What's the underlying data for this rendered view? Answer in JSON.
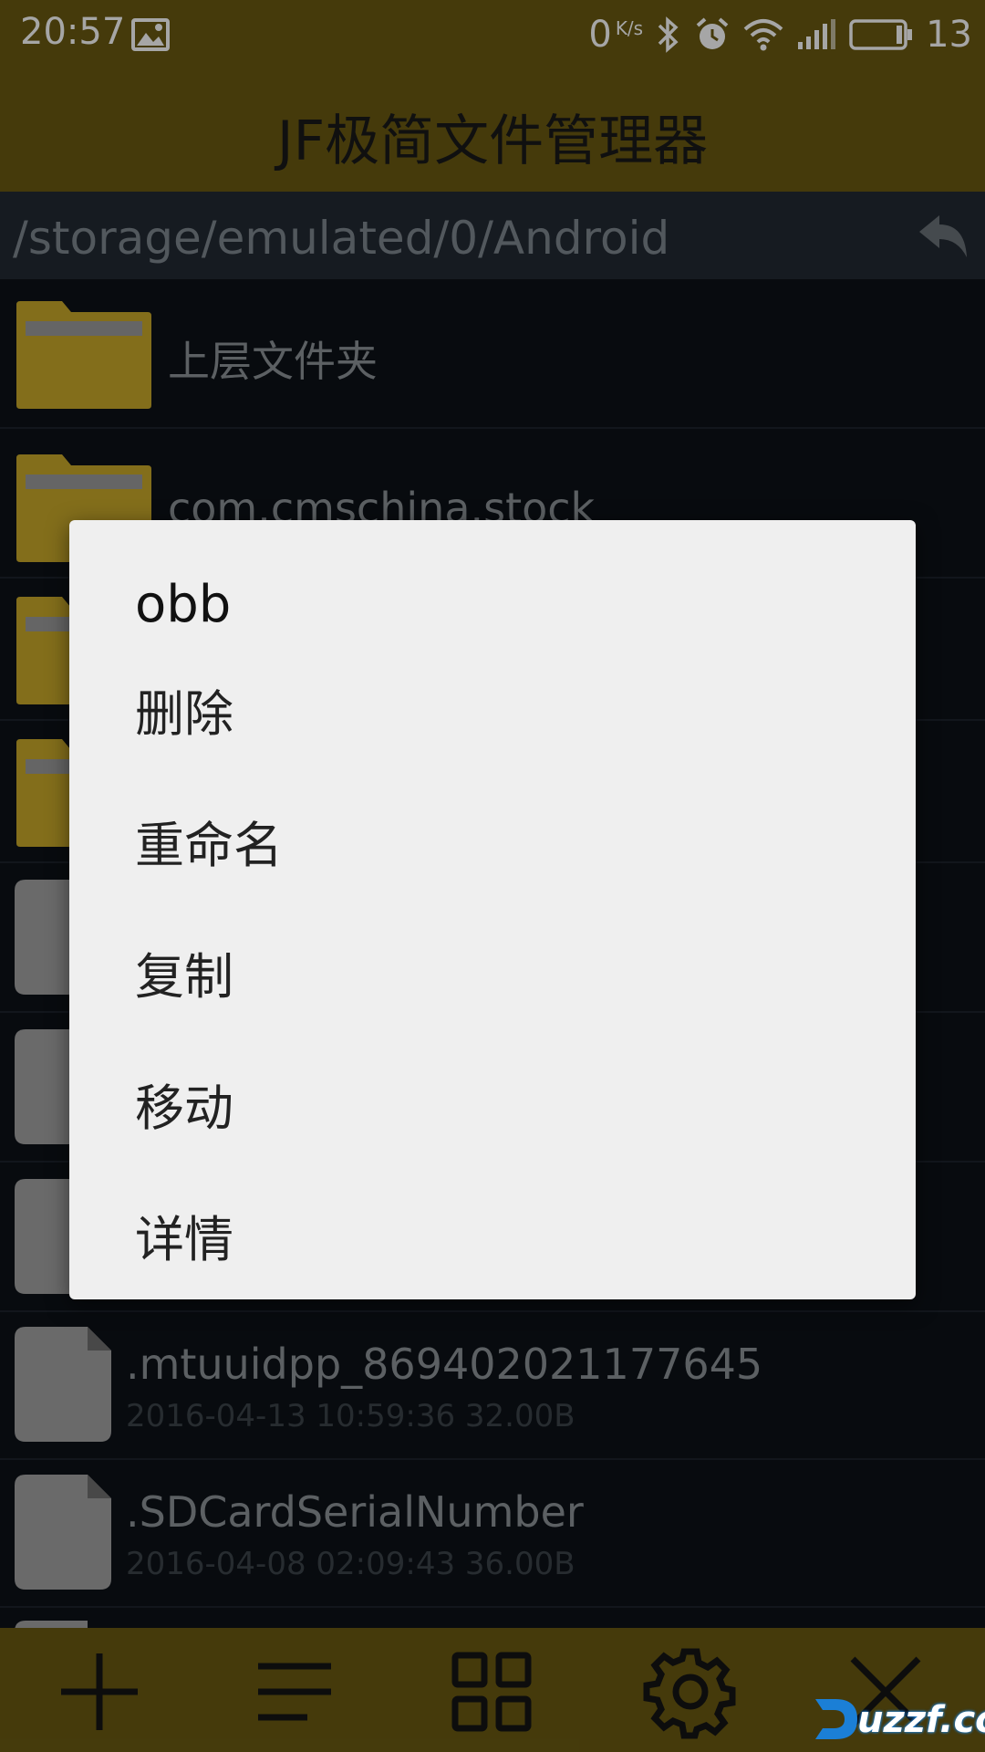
{
  "status_bar": {
    "time": "20:57",
    "speed_value": "0",
    "speed_unit": "K/s",
    "battery": "13"
  },
  "app": {
    "title": "JF极简文件管理器"
  },
  "path": {
    "current": "/storage/emulated/0/Android"
  },
  "files": [
    {
      "name": "上层文件夹",
      "meta": "",
      "type": "folder"
    },
    {
      "name": "com.cmschina.stock",
      "meta": "",
      "type": "folder"
    },
    {
      "name": "",
      "meta": "",
      "type": "folder"
    },
    {
      "name": "",
      "meta": "",
      "type": "folder"
    },
    {
      "name": "",
      "meta": "",
      "type": "file"
    },
    {
      "name": "",
      "meta": "",
      "type": "file"
    },
    {
      "name": "",
      "meta": "",
      "type": "file"
    },
    {
      "name": ".mtuuidpp_869402021177645",
      "meta": "2016-04-13 10:59:36 32.00B",
      "type": "file"
    },
    {
      "name": ".SDCardSerialNumber",
      "meta": "2016-04-08 02:09:43 36.00B",
      "type": "file"
    }
  ],
  "context_menu": {
    "title": "obb",
    "items": [
      "删除",
      "重命名",
      "复制",
      "移动",
      "详情"
    ]
  },
  "toolbar": {
    "icons": [
      "plus-icon",
      "list-icon",
      "grid-icon",
      "gear-icon",
      "close-icon"
    ]
  },
  "watermark": {
    "text": "uzzf.com"
  },
  "colors": {
    "accent": "#6a5a12",
    "folder": "#c9a92a",
    "menu_bg": "#efefef"
  }
}
